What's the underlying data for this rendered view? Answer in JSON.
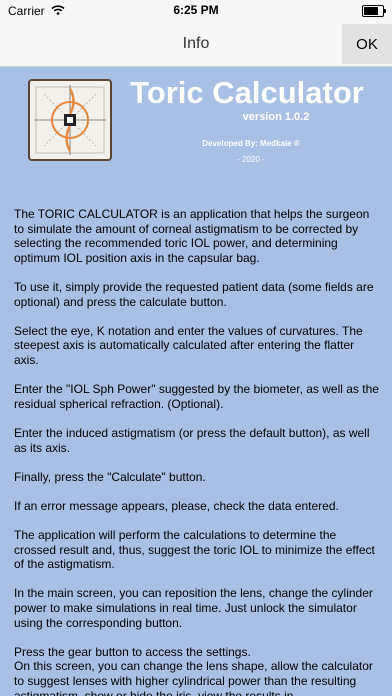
{
  "status_bar": {
    "carrier": "Carrier",
    "time": "6:25 PM",
    "battery_level": 0.9
  },
  "nav": {
    "title": "Info",
    "ok_label": "OK"
  },
  "header": {
    "app_title": "Toric Calculator",
    "version": "version 1.0.2",
    "developer": "Developed By: Medkale ®",
    "year": "- 2020 -"
  },
  "colors": {
    "background": "#a8c0e4",
    "nav_bar": "#f7f7f7",
    "ok_button": "#e2e2e2",
    "logo_orange": "#e8883a",
    "logo_border": "#5a4632"
  },
  "paragraphs": [
    "The TORIC CALCULATOR is an application that helps the surgeon to simulate the amount of corneal astigmatism to be corrected by selecting the recommended toric IOL power, and determining optimum IOL position axis in the capsular bag.",
    "To use it, simply provide the requested patient data (some fields are optional) and press the calculate button.",
    "Select the eye, K notation and enter the values of curvatures. The steepest axis is automatically calculated after entering the flatter axis.",
    "Enter the \"IOL Sph Power\" suggested by the biometer, as well as the residual spherical refraction. (Optional).",
    "Enter the induced astigmatism (or press the default button), as well as its axis.",
    "Finally, press the \"Calculate\" button.",
    "If an error message appears, please, check the data entered.",
    "The application will perform the calculations to determine the crossed result and, thus, suggest the toric IOL to minimize the effect of the astigmatism.",
    "In the main screen, you can reposition the lens, change the cylinder power to make simulations in real time. Just unlock the simulator using the corresponding button.",
    "Press the gear button to access the settings.",
    "On this screen, you can change the lens shape, allow the calculator to suggest lenses with higher cylindrical power than the resulting astigmatism, show or hide the iris, view the results in"
  ]
}
